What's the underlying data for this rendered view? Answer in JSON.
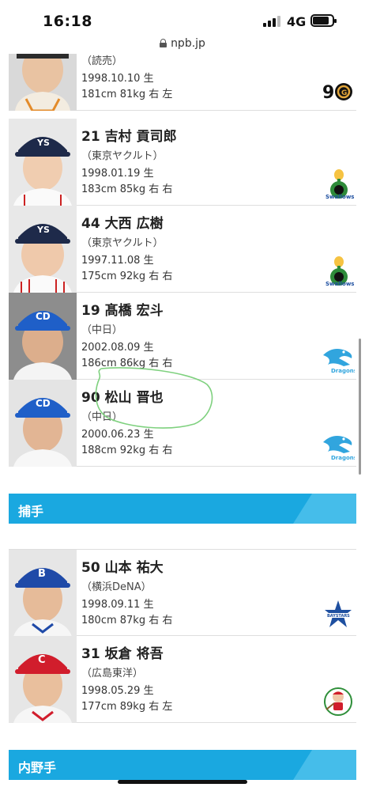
{
  "status_bar": {
    "time": "16:18",
    "network": "4G"
  },
  "browser": {
    "url": "npb.jp"
  },
  "players": [
    {
      "number": "",
      "name": "",
      "team": "（読売）",
      "birth": "1998.10.10 生",
      "body": "181cm 81kg 右 左",
      "logo": "giants-90th-logo"
    },
    {
      "number": "21",
      "name": "吉村 貢司郎",
      "team": "（東京ヤクルト）",
      "birth": "1998.01.19 生",
      "body": "183cm 85kg 右 右",
      "logo": "swallows-logo"
    },
    {
      "number": "44",
      "name": "大西 広樹",
      "team": "（東京ヤクルト）",
      "birth": "1997.11.08 生",
      "body": "175cm 92kg 右 右",
      "logo": "swallows-logo"
    },
    {
      "number": "19",
      "name": "髙橋 宏斗",
      "team": "（中日）",
      "birth": "2002.08.09 生",
      "body": "186cm 86kg 右 右",
      "logo": "dragons-logo"
    },
    {
      "number": "90",
      "name": "松山 晋也",
      "team": "（中日）",
      "birth": "2000.06.23 生",
      "body": "188cm 92kg 右 右",
      "logo": "dragons-logo"
    }
  ],
  "catcher_section": {
    "title": "捕手",
    "players": [
      {
        "number": "50",
        "name": "山本 祐大",
        "team": "（横浜DeNA）",
        "birth": "1998.09.11 生",
        "body": "180cm 87kg 右 右",
        "logo": "baystars-logo"
      },
      {
        "number": "31",
        "name": "坂倉 将吾",
        "team": "（広島東洋）",
        "birth": "1998.05.29 生",
        "body": "177cm 89kg 右 左",
        "logo": "carp-logo"
      }
    ]
  },
  "infielder_section": {
    "title": "内野手"
  },
  "colors": {
    "section_header": "#1aa8e0",
    "annotation": "#7fd17f"
  }
}
